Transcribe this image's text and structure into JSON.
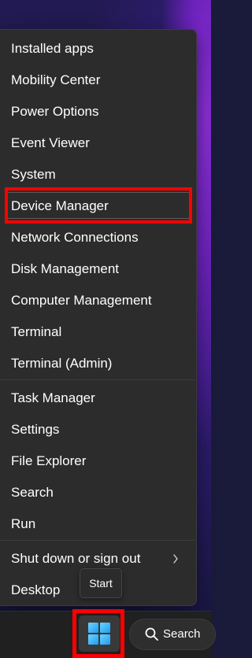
{
  "menu": {
    "items": [
      {
        "label": "Installed apps"
      },
      {
        "label": "Mobility Center"
      },
      {
        "label": "Power Options"
      },
      {
        "label": "Event Viewer"
      },
      {
        "label": "System"
      },
      {
        "label": "Device Manager"
      },
      {
        "label": "Network Connections"
      },
      {
        "label": "Disk Management"
      },
      {
        "label": "Computer Management"
      },
      {
        "label": "Terminal"
      },
      {
        "label": "Terminal (Admin)"
      },
      {
        "label": "Task Manager"
      },
      {
        "label": "Settings"
      },
      {
        "label": "File Explorer"
      },
      {
        "label": "Search"
      },
      {
        "label": "Run"
      },
      {
        "label": "Shut down or sign out",
        "submenu_icon": "chevron-right-icon"
      },
      {
        "label": "Desktop"
      }
    ],
    "highlighted_item": "Device Manager"
  },
  "tooltip": {
    "text": "Start"
  },
  "taskbar": {
    "start_icon": "windows-logo-icon",
    "search": {
      "label": "Search",
      "icon": "search-icon"
    }
  },
  "colors": {
    "menu_background": "#2c2c2c",
    "highlight_outline": "#ff0000",
    "windows_logo": "#1c9df0",
    "taskbar_background": "#202020"
  }
}
